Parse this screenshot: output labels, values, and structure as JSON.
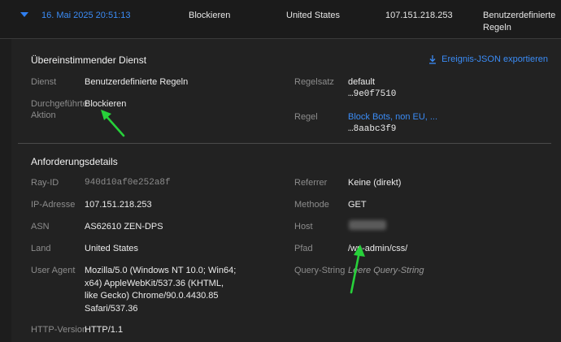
{
  "row": {
    "date": "16. Mai 2025 20:51:13",
    "action": "Blockieren",
    "country": "United States",
    "ip": "107.151.218.253",
    "service_line1": "Benutzerdefinierte",
    "service_line2": "Regeln"
  },
  "matched": {
    "title": "Übereinstimmender Dienst",
    "export_label": "Ereignis-JSON exportieren",
    "service_label": "Dienst",
    "service_value": "Benutzerdefinierte Regeln",
    "action_label_line1": "Durchgeführte",
    "action_label_line2": "Aktion",
    "action_value": "Blockieren",
    "ruleset_label": "Regelsatz",
    "ruleset_value": "default",
    "ruleset_id": "…9e0f7510",
    "rule_label": "Regel",
    "rule_value": "Block Bots, non EU, ...",
    "rule_id": "…8aabc3f9"
  },
  "request": {
    "title": "Anforderungsdetails",
    "ray_label": "Ray-ID",
    "ray_value": "940d10af0e252a8f",
    "ip_label": "IP-Adresse",
    "ip_value": "107.151.218.253",
    "asn_label": "ASN",
    "asn_value": "AS62610 ZEN-DPS",
    "country_label": "Land",
    "country_value": "United States",
    "ua_label": "User Agent",
    "ua_line1": "Mozilla/5.0 (Windows NT 10.0; Win64;",
    "ua_line2": "x64) AppleWebKit/537.36 (KHTML,",
    "ua_line3": "like Gecko) Chrome/90.0.4430.85",
    "ua_line4": "Safari/537.36",
    "http_label": "HTTP-Version",
    "http_value": "HTTP/1.1",
    "referrer_label": "Referrer",
    "referrer_value": "Keine (direkt)",
    "method_label": "Methode",
    "method_value": "GET",
    "host_label": "Host",
    "path_label": "Pfad",
    "path_value": "/wp-admin/css/",
    "query_label": "Query-String",
    "query_value": "Leere Query-String"
  },
  "icons": {
    "expand": "chevron-down-icon",
    "export": "download-icon",
    "annotation": "arrow-icon"
  },
  "colors": {
    "accent": "#3b8cf6",
    "annotation": "#27d13a"
  }
}
